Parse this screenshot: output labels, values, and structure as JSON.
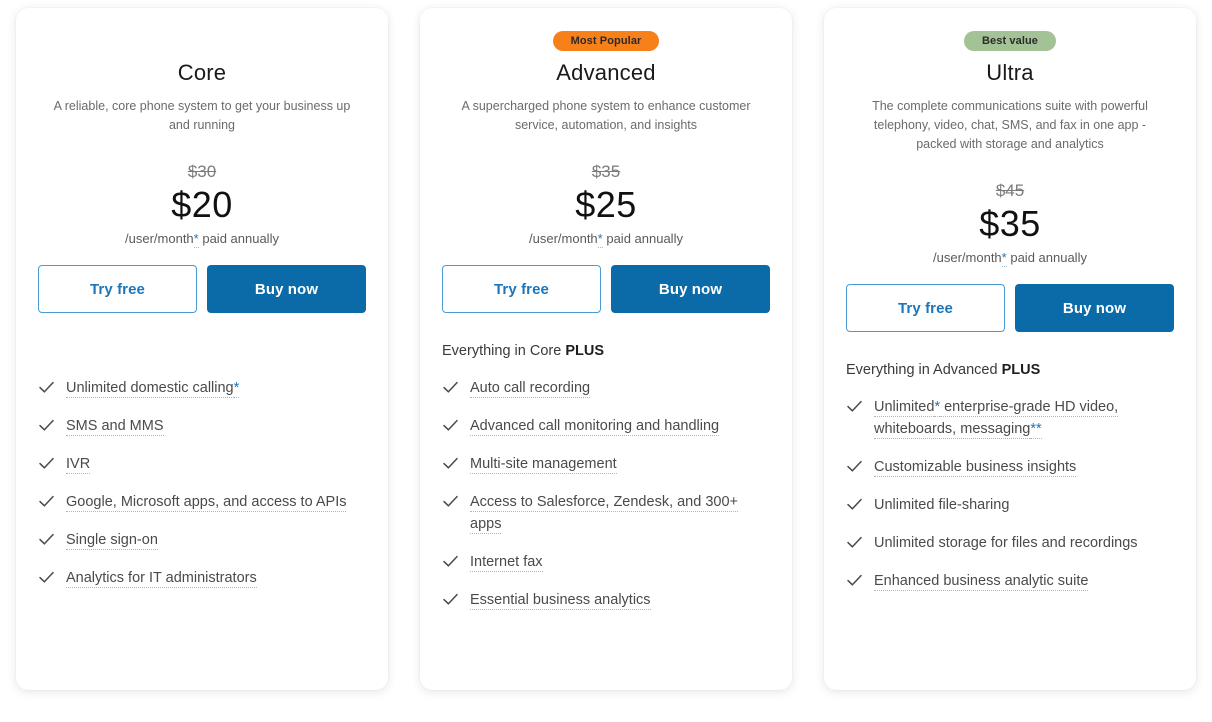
{
  "cards": [
    {
      "badge": {
        "label": "",
        "style": "none"
      },
      "name": "Core",
      "description": "A reliable, core phone system to get your business up and running",
      "price_old": "$30",
      "price_new": "$20",
      "terms_prefix": "/user/month",
      "terms_asterisk": "*",
      "terms_suffix": " paid annually",
      "try_label": "Try free",
      "buy_label": "Buy now",
      "features_intro": "",
      "features_intro_bold": "",
      "features": [
        {
          "text": "Unlimited domestic calling",
          "asterisk": "*",
          "dotted": true
        },
        {
          "text": "SMS and MMS",
          "asterisk": "",
          "dotted": true
        },
        {
          "text": "IVR",
          "asterisk": "",
          "dotted": true
        },
        {
          "text": "Google, Microsoft apps, and access to APIs",
          "asterisk": "",
          "dotted": true
        },
        {
          "text": "Single sign-on",
          "asterisk": "",
          "dotted": true
        },
        {
          "text": "Analytics for IT administrators",
          "asterisk": "",
          "dotted": true
        }
      ]
    },
    {
      "badge": {
        "label": "Most Popular",
        "style": "popular"
      },
      "name": "Advanced",
      "description": "A supercharged phone system to enhance customer service, automation, and insights",
      "price_old": "$35",
      "price_new": "$25",
      "terms_prefix": "/user/month",
      "terms_asterisk": "*",
      "terms_suffix": " paid annually",
      "try_label": "Try free",
      "buy_label": "Buy now",
      "features_intro": "Everything in Core ",
      "features_intro_bold": "PLUS",
      "features": [
        {
          "text": "Auto call recording",
          "asterisk": "",
          "dotted": true
        },
        {
          "text": "Advanced call monitoring and handling",
          "asterisk": "",
          "dotted": true
        },
        {
          "text": "Multi-site management",
          "asterisk": "",
          "dotted": true
        },
        {
          "text": "Access to Salesforce, Zendesk, and 300+ apps",
          "asterisk": "",
          "dotted": true
        },
        {
          "text": "Internet fax",
          "asterisk": "",
          "dotted": true
        },
        {
          "text": "Essential business analytics",
          "asterisk": "",
          "dotted": true
        }
      ]
    },
    {
      "badge": {
        "label": "Best value",
        "style": "best"
      },
      "name": "Ultra",
      "description": "The complete communications suite with powerful telephony, video, chat, SMS, and fax in one app - packed with storage and analytics",
      "price_old": "$45",
      "price_new": "$35",
      "terms_prefix": "/user/month",
      "terms_asterisk": "*",
      "terms_suffix": " paid annually",
      "try_label": "Try free",
      "buy_label": "Buy now",
      "features_intro": "Everything in Advanced ",
      "features_intro_bold": "PLUS",
      "features": [
        {
          "text": "Unlimited",
          "asterisk": "*",
          "text_after": " enterprise-grade HD video, whiteboards, messaging",
          "asterisk_after": "**",
          "dotted": true
        },
        {
          "text": "Customizable business insights",
          "asterisk": "",
          "dotted": true
        },
        {
          "text": "Unlimited file-sharing",
          "asterisk": "",
          "dotted": false
        },
        {
          "text": "Unlimited storage for files and recordings",
          "asterisk": "",
          "dotted": false
        },
        {
          "text": "Enhanced business analytic suite",
          "asterisk": "",
          "dotted": true
        }
      ]
    }
  ],
  "colors": {
    "badge_popular": "#F78019",
    "badge_best": "#A3C295",
    "button_solid": "#0a6BA8",
    "button_outline_text": "#1b76bc",
    "asterisk_link": "#1b76bc"
  },
  "icons": {
    "check": "check-icon"
  }
}
